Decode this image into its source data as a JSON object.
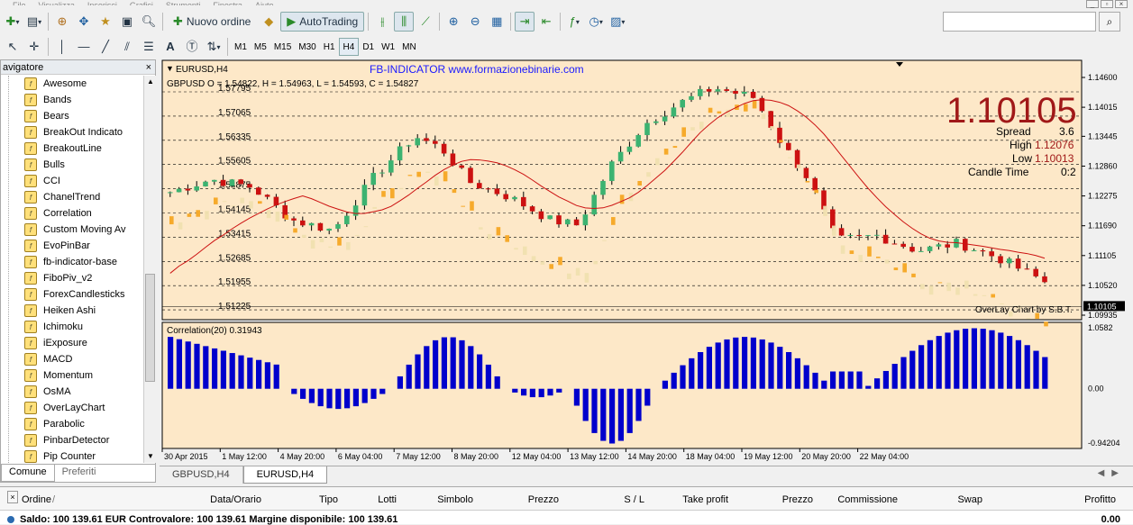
{
  "menu": [
    "File",
    "Visualizza",
    "Inserisci",
    "Grafici",
    "Strumenti",
    "Finestra",
    "Aiuto"
  ],
  "toolbar": {
    "new_order": "Nuovo ordine",
    "autotrading": "AutoTrading",
    "timeframes": [
      "M1",
      "M5",
      "M15",
      "M30",
      "H1",
      "H4",
      "D1",
      "W1",
      "MN"
    ],
    "active_timeframe": "H4"
  },
  "navigator": {
    "title": "avigatore",
    "items": [
      "Awesome",
      "Bands",
      "Bears",
      "BreakOut Indicato",
      "BreakoutLine",
      "Bulls",
      "CCI",
      "ChanelTrend",
      "Correlation",
      "Custom Moving Av",
      "EvoPinBar",
      "fb-indicator-base",
      "FiboPiv_v2",
      "ForexCandlesticks",
      "Heiken Ashi",
      "Ichimoku",
      "iExposure",
      "MACD",
      "Momentum",
      "OsMA",
      "OverLayChart",
      "Parabolic",
      "PinbarDetector",
      "Pip Counter"
    ],
    "tabs": [
      "Comune",
      "Preferiti"
    ]
  },
  "chart": {
    "symbol_title": "EURUSD,H4",
    "brand": "FB-INDICATOR  www.formazionebinarie.com",
    "ohlc_line": "GBPUSD O = 1.54822, H = 1.54963, L = 1.54593, C = 1.54827",
    "big_price": "1.10105",
    "spread_label": "Spread",
    "spread_value": "3.6",
    "high_label": "High",
    "high_value": "1.12076",
    "low_label": "Low",
    "low_value": "1.10013",
    "candle_time_label": "Candle Time",
    "candle_time_value": "0:2",
    "overlay_label": "OverLay Chart by S.B.T.",
    "price_axis": [
      "1.14600",
      "1.14015",
      "1.13445",
      "1.12860",
      "1.12275",
      "1.11690",
      "1.11105",
      "1.10520",
      "1.09935"
    ],
    "current_price_tag": "1.10105",
    "overlay_levels": [
      "1.57795",
      "1.57065",
      "1.56335",
      "1.55605",
      "1.54875",
      "1.54145",
      "1.53415",
      "1.52685",
      "1.51955",
      "1.51225"
    ],
    "correlation_label": "Correlation(20) 0.31943",
    "corr_axis": [
      "1.0582",
      "0.00",
      "-0.94204"
    ],
    "date_axis": [
      "30 Apr 2015",
      "1 May 12:00",
      "4 May 20:00",
      "6 May 04:00",
      "7 May 12:00",
      "8 May 20:00",
      "12 May 04:00",
      "13 May 12:00",
      "14 May 20:00",
      "18 May 04:00",
      "19 May 12:00",
      "20 May 20:00",
      "22 May 04:00"
    ],
    "colors": {
      "background": "#fde8c8",
      "bull": "#3cb371",
      "bear": "#cc1111",
      "overlay_bull": "#f5a623",
      "overlay_bear": "#f0e0b0",
      "ma": "#cc1111",
      "histogram": "#0000cc",
      "big_price": "#a01818"
    }
  },
  "chart_tabs": [
    "GBPUSD,H4",
    "EURUSD,H4"
  ],
  "active_chart_tab": "EURUSD,H4",
  "terminal": {
    "columns": [
      "Ordine",
      "Data/Orario",
      "Tipo",
      "Lotti",
      "Simbolo",
      "Prezzo",
      "S / L",
      "Take profit",
      "Prezzo",
      "Commissione",
      "Swap",
      "Profitto"
    ],
    "balance_line": "Saldo: 100 139.61 EUR  Controvalore: 100 139.61  Margine disponibile: 100 139.61",
    "profit_total": "0.00"
  }
}
